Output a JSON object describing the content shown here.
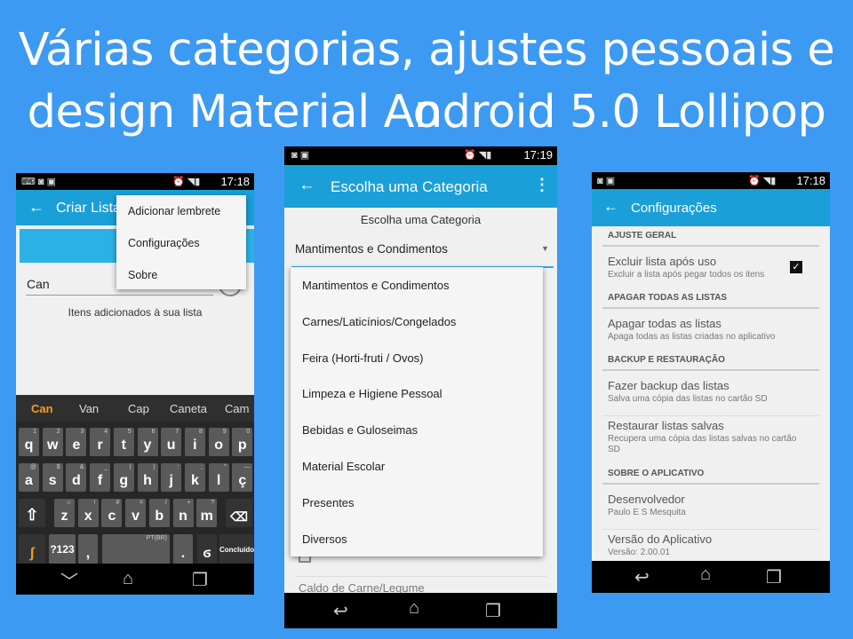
{
  "headline": {
    "line1": "Várias categorias, ajustes pessoais e o",
    "line2": "design Material Android 5.0 Lollipop"
  },
  "colors": {
    "background": "#3d9af3",
    "appbar": "#1a9fd9",
    "band": "#2cb1e6"
  },
  "phone1": {
    "time": "17:18",
    "appbar_title": "Criar Lista",
    "back_icon": "arrow-left-icon",
    "menu": [
      "Adicionar lembrete",
      "Configurações",
      "Sobre"
    ],
    "input_value": "Can",
    "empty_text": "Itens adicionados à sua lista",
    "suggestions": [
      "Can",
      "Van",
      "Cap",
      "Caneta",
      "Cam"
    ],
    "row1": [
      [
        "q",
        "1"
      ],
      [
        "w",
        "2"
      ],
      [
        "e",
        "3"
      ],
      [
        "r",
        "4"
      ],
      [
        "t",
        "5"
      ],
      [
        "y",
        "6"
      ],
      [
        "u",
        "7"
      ],
      [
        "i",
        "8"
      ],
      [
        "o",
        "9"
      ],
      [
        "p",
        "0"
      ]
    ],
    "row2": [
      [
        "a",
        "@"
      ],
      [
        "s",
        "$"
      ],
      [
        "d",
        "&"
      ],
      [
        "f",
        "_"
      ],
      [
        "g",
        "("
      ],
      [
        "h",
        ")"
      ],
      [
        "j",
        ":"
      ],
      [
        "k",
        ";"
      ],
      [
        "l",
        "\""
      ],
      [
        "ç",
        "—"
      ]
    ],
    "row3": [
      [
        "z",
        "☺"
      ],
      [
        "x",
        "!"
      ],
      [
        "c",
        "#"
      ],
      [
        "v",
        "="
      ],
      [
        "b",
        "/"
      ],
      [
        "n",
        "+"
      ],
      [
        "m",
        "?"
      ]
    ],
    "symbols_key": "?123",
    "comma_key": ",",
    "space_label": "PT(BR)",
    "period_key": ".",
    "done_key": "Concluído"
  },
  "phone2": {
    "time": "17:19",
    "appbar_title": "Escolha uma Categoria",
    "heading": "Escolha uma Categoria",
    "selected": "Mantimentos e Condimentos",
    "options": [
      "Mantimentos e Condimentos",
      "Carnes/Laticínios/Congelados",
      "Feira (Horti-fruti / Ovos)",
      "Limpeza e Higiene Pessoal",
      "Bebidas e Guloseimas",
      "Material Escolar",
      "Presentes",
      "Diversos"
    ],
    "behind_item": "Caldo de Carne/Legume"
  },
  "phone3": {
    "time": "17:18",
    "appbar_title": "Configurações",
    "sections": [
      {
        "header": "AJUSTE GERAL",
        "items": [
          {
            "title": "Excluir lista após uso",
            "subtitle": "Excluir a lista após pegar todos os itens",
            "checked": true
          }
        ]
      },
      {
        "header": "APAGAR TODAS AS LISTAS",
        "items": [
          {
            "title": "Apagar todas as listas",
            "subtitle": "Apaga todas as listas criadas no aplicativo"
          }
        ]
      },
      {
        "header": "BACKUP E RESTAURAÇÃO",
        "items": [
          {
            "title": "Fazer backup das listas",
            "subtitle": "Salva uma cópia das listas no cartão SD"
          },
          {
            "title": "Restaurar listas salvas",
            "subtitle": "Recupera uma cópia das listas salvas no cartão SD"
          }
        ]
      },
      {
        "header": "SOBRE O APLICATIVO",
        "items": [
          {
            "title": "Desenvolvedor",
            "subtitle": "Paulo E S Mesquita"
          },
          {
            "title": "Versão do Aplicativo",
            "subtitle": "Versão: 2.00.01"
          }
        ]
      }
    ]
  }
}
